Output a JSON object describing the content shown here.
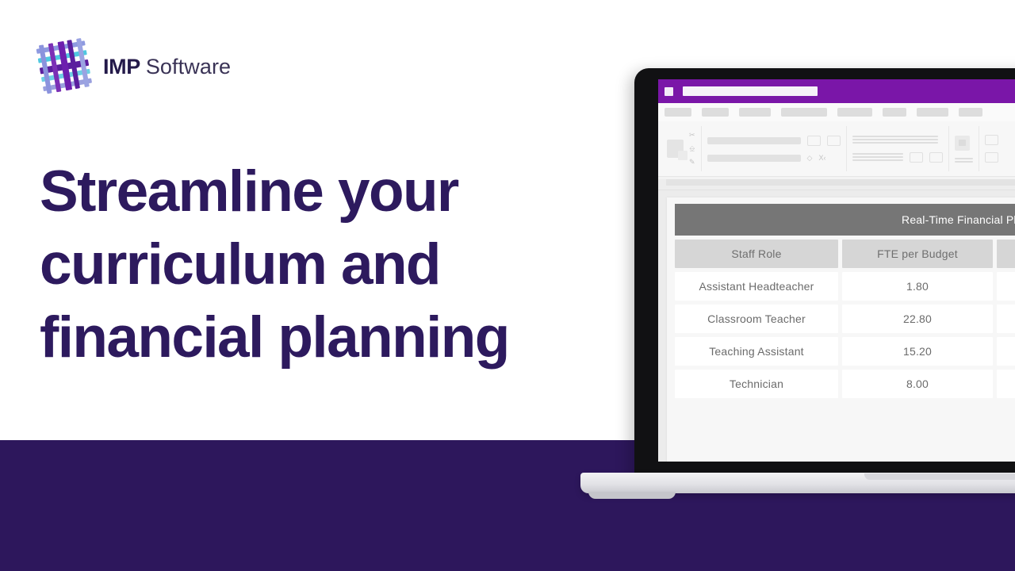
{
  "brand": {
    "name_bold": "IMP",
    "name_light": "Software",
    "logo_icon": "hash-weave-logo-icon",
    "accent_purple": "#2d1a5e",
    "accent_cyan": "#5ad3e6"
  },
  "hero": {
    "line1": "Streamline your",
    "line2": "curriculum and",
    "line3": "financial planning",
    "text_color": "#2d1a5e",
    "band_color": "#2d175c"
  },
  "app": {
    "titlebar_color": "#7a16a8",
    "titlebar_icon": "app-square-icon",
    "tab_count": 8,
    "ribbon_groups": 5,
    "ruler_label": "",
    "status_scroll": "horizontal-scrollbar"
  },
  "table": {
    "title": "Real-Time Financial Planning",
    "headers": [
      "Staff Role",
      "FTE per Budget",
      ""
    ],
    "rows": [
      {
        "role": "Assistant Headteacher",
        "fte": "1.80",
        "extra": ""
      },
      {
        "role": "Classroom Teacher",
        "fte": "22.80",
        "extra": ""
      },
      {
        "role": "Teaching Assistant",
        "fte": "15.20",
        "extra": ""
      },
      {
        "role": "Technician",
        "fte": "8.00",
        "extra": ""
      }
    ],
    "header_bg": "#d6d6d6",
    "title_bg": "#767676",
    "cell_bg": "#ffffff"
  }
}
